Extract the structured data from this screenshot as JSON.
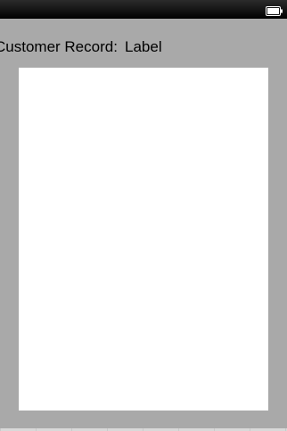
{
  "status_bar": {
    "battery_icon": "battery-full-icon"
  },
  "header": {
    "title": "Customer Record:",
    "value": "Label"
  },
  "colors": {
    "status_bar": "#000000",
    "view_background": "#a9a9a9",
    "panel_background": "#ffffff"
  }
}
